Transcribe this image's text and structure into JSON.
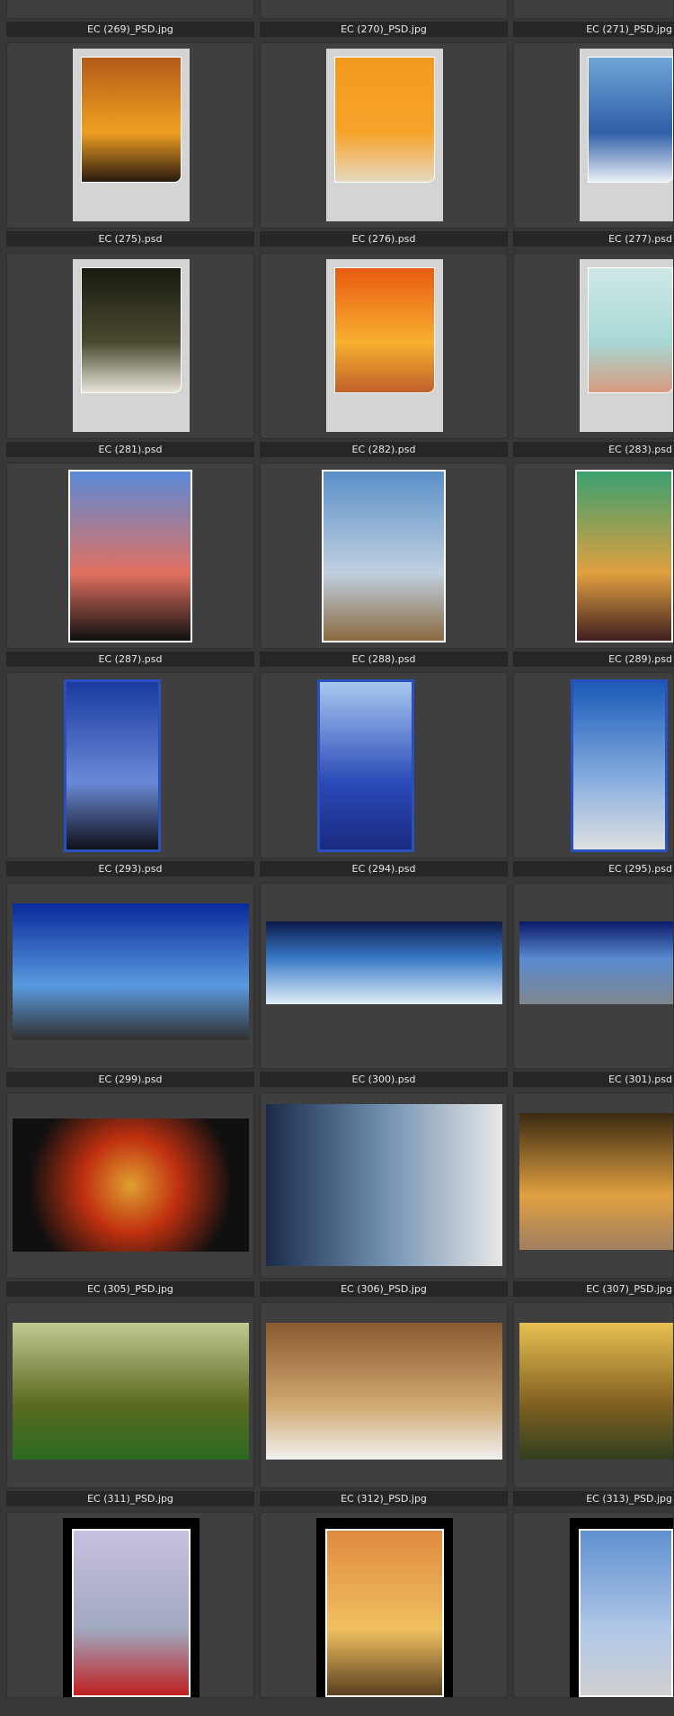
{
  "browser": {
    "items": [
      {
        "label": "EC (269)_PSD.jpg",
        "kind": "partial",
        "colors": [
          "#6b4a1c",
          "#a0701e"
        ]
      },
      {
        "label": "EC (270)_PSD.jpg",
        "kind": "partial",
        "colors": [
          "#4a3a20",
          "#7a5a20"
        ]
      },
      {
        "label": "EC (271)_PSD.jpg",
        "kind": "partial",
        "colors": [
          "#a08020",
          "#c8a040"
        ]
      },
      {
        "label": "EC (275).psd",
        "kind": "gray",
        "colors": [
          "#b35a1a",
          "#f0a020",
          "#2a1a10"
        ]
      },
      {
        "label": "EC (276).psd",
        "kind": "gray",
        "colors": [
          "#f39a1e",
          "#f7a32a",
          "#e8d8c0"
        ]
      },
      {
        "label": "EC (277).psd",
        "kind": "gray",
        "colors": [
          "#6fa6d8",
          "#2f5fa8",
          "#e8eef5"
        ]
      },
      {
        "label": "EC (281).psd",
        "kind": "gray",
        "colors": [
          "#1a1a10",
          "#4a4a30",
          "#e8e4d8"
        ]
      },
      {
        "label": "EC (282).psd",
        "kind": "gray",
        "colors": [
          "#e85a10",
          "#f7b030",
          "#c0602a"
        ]
      },
      {
        "label": "EC (283).psd",
        "kind": "gray",
        "colors": [
          "#cfe9e8",
          "#a8d8d4",
          "#d89a80"
        ]
      },
      {
        "label": "EC (287).psd",
        "kind": "white",
        "colors": [
          "#5a8ad8",
          "#e07060",
          "#101010"
        ]
      },
      {
        "label": "EC (288).psd",
        "kind": "white",
        "colors": [
          "#5a90c8",
          "#c0d0e0",
          "#8a6a40"
        ]
      },
      {
        "label": "EC (289).psd",
        "kind": "white",
        "colors": [
          "#3aa070",
          "#e0a040",
          "#402020"
        ]
      },
      {
        "label": "EC (293).psd",
        "kind": "blue",
        "colors": [
          "#1a3aa0",
          "#6a8ad8",
          "#101018"
        ]
      },
      {
        "label": "EC (294).psd",
        "kind": "blue",
        "colors": [
          "#a8c8f0",
          "#2a4ab8",
          "#1a2a80"
        ]
      },
      {
        "label": "EC (295).psd",
        "kind": "blue",
        "colors": [
          "#1a5ab8",
          "#8ab0e0",
          "#e0e0e0"
        ]
      },
      {
        "label": "EC (299).psd",
        "kind": "land",
        "colors": [
          "#0a2a9a",
          "#5a9ae0",
          "#303030"
        ]
      },
      {
        "label": "EC (300).psd",
        "kind": "wide",
        "colors": [
          "#0a1a4a",
          "#3a7ac8",
          "#e0eef8"
        ]
      },
      {
        "label": "EC (301).psd",
        "kind": "wide",
        "colors": [
          "#0a1a6a",
          "#5a8ad0",
          "#808890"
        ]
      },
      {
        "label": "EC (305)_PSD.jpg",
        "kind": "land-black",
        "colors": [
          "#101010",
          "#c03010",
          "#e0a030"
        ]
      },
      {
        "label": "EC (306)_PSD.jpg",
        "kind": "land-tall",
        "colors": [
          "#1a2a4a",
          "#e8e8e8",
          "#7090b0"
        ]
      },
      {
        "label": "EC (307)_PSD.jpg",
        "kind": "land",
        "colors": [
          "#3a2a10",
          "#e0a040",
          "#a08060"
        ]
      },
      {
        "label": "EC (311)_PSD.jpg",
        "kind": "land",
        "colors": [
          "#c0c890",
          "#5a6a20",
          "#2a6a20"
        ]
      },
      {
        "label": "EC (312)_PSD.jpg",
        "kind": "land",
        "colors": [
          "#8a5a30",
          "#d0a870",
          "#f0f0f0"
        ]
      },
      {
        "label": "EC (313)_PSD.jpg",
        "kind": "land",
        "colors": [
          "#e8c050",
          "#806020",
          "#304020"
        ]
      },
      {
        "label": "",
        "kind": "black",
        "colors": [
          "#c8c0e0",
          "#a0a8c0",
          "#c02020"
        ]
      },
      {
        "label": "",
        "kind": "black",
        "colors": [
          "#e08a40",
          "#f0c060",
          "#5a4020"
        ]
      },
      {
        "label": "",
        "kind": "black",
        "colors": [
          "#6090d0",
          "#b0c8e8",
          "#d0d0d0"
        ]
      }
    ]
  }
}
